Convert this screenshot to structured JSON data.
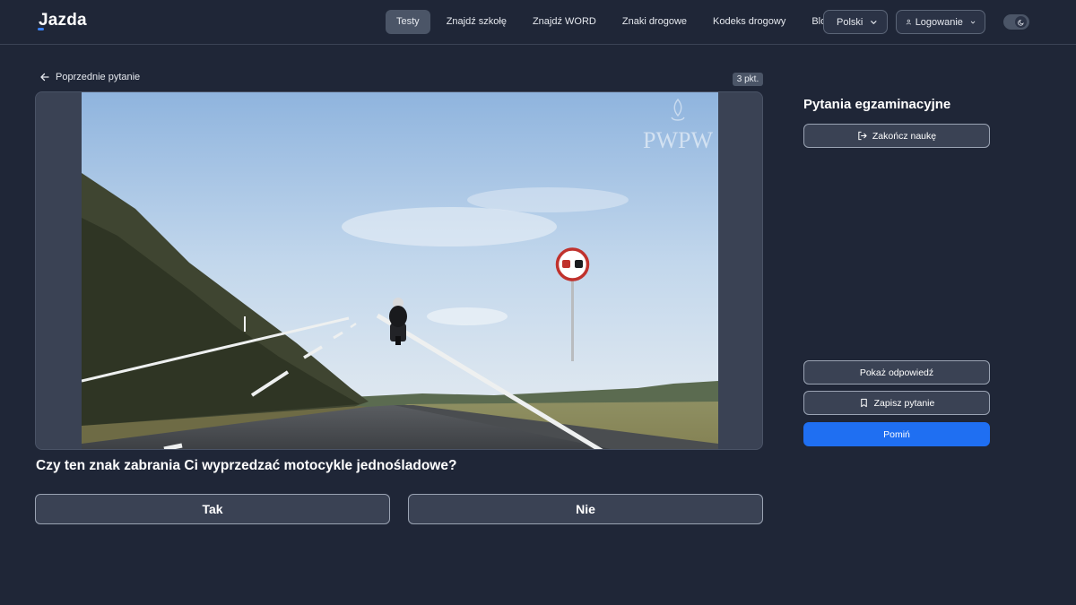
{
  "header": {
    "logo": "Jazda",
    "nav": [
      {
        "label": "Testy",
        "active": true
      },
      {
        "label": "Znajdź szkołę",
        "active": false
      },
      {
        "label": "Znajdź WORD",
        "active": false
      },
      {
        "label": "Znaki drogowe",
        "active": false
      },
      {
        "label": "Kodeks drogowy",
        "active": false
      },
      {
        "label": "Blog",
        "active": false
      }
    ],
    "language": "Polski",
    "login": "Logowanie",
    "theme_icon": "moon-icon"
  },
  "main": {
    "prev_link": "Poprzednie pytanie",
    "points": "3 pkt.",
    "image_watermark": "PWPW",
    "question": "Czy ten znak zabrania Ci wyprzedzać motocykle jednośladowe?",
    "answers": [
      "Tak",
      "Nie"
    ]
  },
  "sidebar": {
    "title": "Pytania egzaminacyjne",
    "finish": "Zakończ naukę",
    "show_answer": "Pokaż odpowiedź",
    "save_question": "Zapisz pytanie",
    "skip": "Pomiń"
  },
  "colors": {
    "background": "#1f2637",
    "panel": "#3a4254",
    "accent": "#1f6ff2"
  }
}
